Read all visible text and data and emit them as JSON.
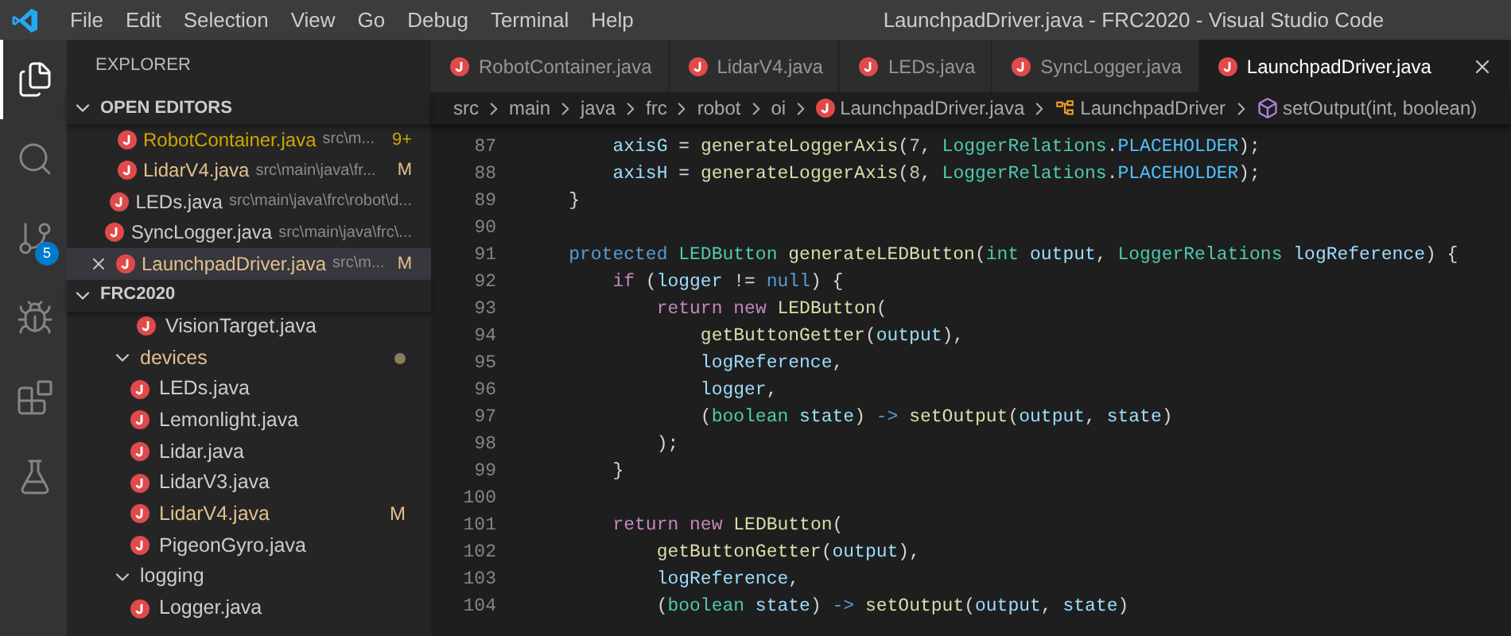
{
  "menu": [
    "File",
    "Edit",
    "Selection",
    "View",
    "Go",
    "Debug",
    "Terminal",
    "Help"
  ],
  "window": {
    "title": "LaunchpadDriver.java - FRC2020 - Visual Studio Code"
  },
  "activity_bar": [
    {
      "kind": "files",
      "selected": true
    },
    {
      "kind": "search",
      "selected": false
    },
    {
      "kind": "source-control",
      "selected": false,
      "badge": "5"
    },
    {
      "kind": "debug",
      "selected": false
    },
    {
      "kind": "extensions",
      "selected": false
    },
    {
      "kind": "testing",
      "selected": false
    }
  ],
  "sidebar": {
    "title": "EXPLORER",
    "open_editors": {
      "label": "OPEN EDITORS",
      "expanded": true,
      "items": [
        {
          "name": "RobotContainer.java",
          "path": "src\\m...",
          "kind": "warning",
          "badge": "9+",
          "selected": false
        },
        {
          "name": "LidarV4.java",
          "path": "src\\main\\java\\fr...",
          "kind": "modified",
          "badge": "M",
          "selected": false
        },
        {
          "name": "LEDs.java",
          "path": "src\\main\\java\\frc\\robot\\d...",
          "kind": "plain",
          "selected": false
        },
        {
          "name": "SyncLogger.java",
          "path": "src\\main\\java\\frc\\...",
          "kind": "plain",
          "selected": false
        },
        {
          "name": "LaunchpadDriver.java",
          "path": "src\\m...",
          "kind": "modified",
          "badge": "M",
          "selected": true
        }
      ]
    },
    "project": {
      "label": "FRC2020",
      "expanded": true,
      "leading_files": [
        {
          "name": "VisionTarget.java",
          "kind": "plain"
        }
      ],
      "folders": [
        {
          "name": "devices",
          "expanded": true,
          "kind": "modified",
          "children": [
            {
              "name": "LEDs.java",
              "kind": "plain"
            },
            {
              "name": "Lemonlight.java",
              "kind": "plain"
            },
            {
              "name": "Lidar.java",
              "kind": "plain"
            },
            {
              "name": "LidarV3.java",
              "kind": "plain"
            },
            {
              "name": "LidarV4.java",
              "kind": "modified",
              "badge": "M"
            },
            {
              "name": "PigeonGyro.java",
              "kind": "plain"
            }
          ]
        },
        {
          "name": "logging",
          "expanded": true,
          "kind": "plain",
          "children": [
            {
              "name": "Logger.java",
              "kind": "plain"
            }
          ]
        }
      ]
    }
  },
  "tabs": [
    {
      "label": "RobotContainer.java",
      "selected": false
    },
    {
      "label": "LidarV4.java",
      "selected": false
    },
    {
      "label": "LEDs.java",
      "selected": false
    },
    {
      "label": "SyncLogger.java",
      "selected": false
    },
    {
      "label": "LaunchpadDriver.java",
      "selected": true
    }
  ],
  "breadcrumb": [
    {
      "kind": "folder",
      "label": "src"
    },
    {
      "kind": "folder",
      "label": "main"
    },
    {
      "kind": "folder",
      "label": "java"
    },
    {
      "kind": "folder",
      "label": "frc"
    },
    {
      "kind": "folder",
      "label": "robot"
    },
    {
      "kind": "folder",
      "label": "oi"
    },
    {
      "kind": "file",
      "label": "LaunchpadDriver.java"
    },
    {
      "kind": "class",
      "label": "LaunchpadDriver"
    },
    {
      "kind": "method",
      "label": "setOutput(int, boolean)"
    }
  ],
  "code": [
    {
      "number": "87",
      "tokens": [
        {
          "kind": "var",
          "text": "        axisG"
        },
        {
          "kind": "p",
          "text": " = "
        },
        {
          "kind": "fn",
          "text": "generateLoggerAxis"
        },
        {
          "kind": "p",
          "text": "("
        },
        {
          "kind": "num",
          "text": "7"
        },
        {
          "kind": "p",
          "text": ", "
        },
        {
          "kind": "type",
          "text": "LoggerRelations"
        },
        {
          "kind": "p",
          "text": "."
        },
        {
          "kind": "const",
          "text": "PLACEHOLDER"
        },
        {
          "kind": "p",
          "text": ");"
        }
      ]
    },
    {
      "number": "88",
      "tokens": [
        {
          "kind": "var",
          "text": "        axisH"
        },
        {
          "kind": "p",
          "text": " = "
        },
        {
          "kind": "fn",
          "text": "generateLoggerAxis"
        },
        {
          "kind": "p",
          "text": "("
        },
        {
          "kind": "num",
          "text": "8"
        },
        {
          "kind": "p",
          "text": ", "
        },
        {
          "kind": "type",
          "text": "LoggerRelations"
        },
        {
          "kind": "p",
          "text": "."
        },
        {
          "kind": "const",
          "text": "PLACEHOLDER"
        },
        {
          "kind": "p",
          "text": ");"
        }
      ]
    },
    {
      "number": "89",
      "tokens": [
        {
          "kind": "p",
          "text": "    }"
        }
      ]
    },
    {
      "number": "90"
    },
    {
      "number": "91",
      "tokens": [
        {
          "kind": "kw",
          "text": "    protected"
        },
        {
          "kind": "type",
          "text": " LEDButton"
        },
        {
          "kind": "fn",
          "text": " generateLEDButton"
        },
        {
          "kind": "p",
          "text": "("
        },
        {
          "kind": "prim",
          "text": "int"
        },
        {
          "kind": "var",
          "text": " output"
        },
        {
          "kind": "p",
          "text": ", "
        },
        {
          "kind": "type",
          "text": "LoggerRelations"
        },
        {
          "kind": "var",
          "text": " logReference"
        },
        {
          "kind": "p",
          "text": ") {"
        }
      ]
    },
    {
      "number": "92",
      "tokens": [
        {
          "kind": "ctrl",
          "text": "        if"
        },
        {
          "kind": "p",
          "text": " ("
        },
        {
          "kind": "var",
          "text": "logger"
        },
        {
          "kind": "p",
          "text": " != "
        },
        {
          "kind": "kw",
          "text": "null"
        },
        {
          "kind": "p",
          "text": ") {"
        }
      ]
    },
    {
      "number": "93",
      "tokens": [
        {
          "kind": "ctrl",
          "text": "            return"
        },
        {
          "kind": "ctrl",
          "text": " new"
        },
        {
          "kind": "fn",
          "text": " LEDButton"
        },
        {
          "kind": "p",
          "text": "("
        }
      ]
    },
    {
      "number": "94",
      "tokens": [
        {
          "kind": "fn",
          "text": "                getButtonGetter"
        },
        {
          "kind": "p",
          "text": "("
        },
        {
          "kind": "var",
          "text": "output"
        },
        {
          "kind": "p",
          "text": "),"
        }
      ]
    },
    {
      "number": "95",
      "tokens": [
        {
          "kind": "var",
          "text": "                logReference"
        },
        {
          "kind": "p",
          "text": ","
        }
      ]
    },
    {
      "number": "96",
      "tokens": [
        {
          "kind": "var",
          "text": "                logger"
        },
        {
          "kind": "p",
          "text": ","
        }
      ]
    },
    {
      "number": "97",
      "tokens": [
        {
          "kind": "p",
          "text": "                ("
        },
        {
          "kind": "prim",
          "text": "boolean"
        },
        {
          "kind": "var",
          "text": " state"
        },
        {
          "kind": "p",
          "text": ") "
        },
        {
          "kind": "kw",
          "text": "->"
        },
        {
          "kind": "fn",
          "text": " setOutput"
        },
        {
          "kind": "p",
          "text": "("
        },
        {
          "kind": "var",
          "text": "output"
        },
        {
          "kind": "p",
          "text": ", "
        },
        {
          "kind": "var",
          "text": "state"
        },
        {
          "kind": "p",
          "text": ")"
        }
      ]
    },
    {
      "number": "98",
      "tokens": [
        {
          "kind": "p",
          "text": "            );"
        }
      ]
    },
    {
      "number": "99",
      "tokens": [
        {
          "kind": "p",
          "text": "        }"
        }
      ]
    },
    {
      "number": "100"
    },
    {
      "number": "101",
      "tokens": [
        {
          "kind": "ctrl",
          "text": "        return"
        },
        {
          "kind": "ctrl",
          "text": " new"
        },
        {
          "kind": "fn",
          "text": " LEDButton"
        },
        {
          "kind": "p",
          "text": "("
        }
      ]
    },
    {
      "number": "102",
      "tokens": [
        {
          "kind": "fn",
          "text": "            getButtonGetter"
        },
        {
          "kind": "p",
          "text": "("
        },
        {
          "kind": "var",
          "text": "output"
        },
        {
          "kind": "p",
          "text": "),"
        }
      ]
    },
    {
      "number": "103",
      "tokens": [
        {
          "kind": "var",
          "text": "            logReference"
        },
        {
          "kind": "p",
          "text": ","
        }
      ]
    },
    {
      "number": "104",
      "tokens": [
        {
          "kind": "p",
          "text": "            ("
        },
        {
          "kind": "prim",
          "text": "boolean"
        },
        {
          "kind": "var",
          "text": " state"
        },
        {
          "kind": "p",
          "text": ") "
        },
        {
          "kind": "kw",
          "text": "->"
        },
        {
          "kind": "fn",
          "text": " setOutput"
        },
        {
          "kind": "p",
          "text": "("
        },
        {
          "kind": "var",
          "text": "output"
        },
        {
          "kind": "p",
          "text": ", "
        },
        {
          "kind": "var",
          "text": "state"
        },
        {
          "kind": "p",
          "text": ")"
        }
      ]
    }
  ]
}
